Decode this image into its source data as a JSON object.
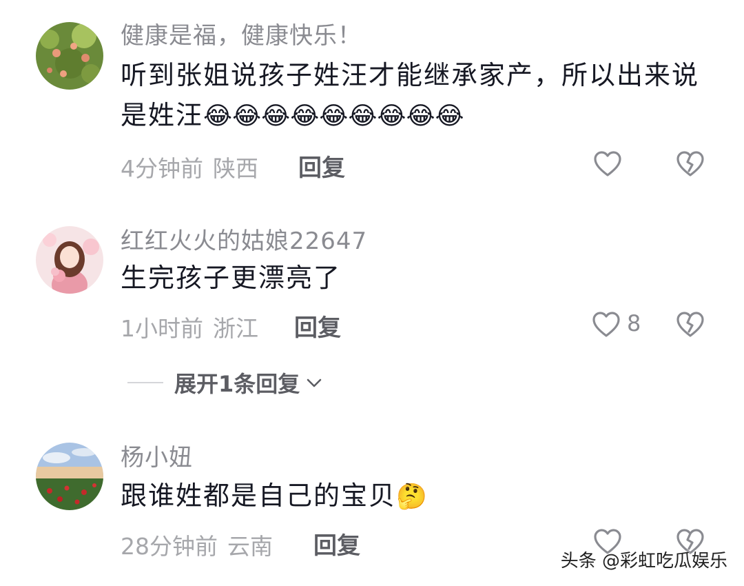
{
  "comments": [
    {
      "username": "健康是福，健康快乐！",
      "text": "听到张姐说孩子姓汪才能继承家产，所以出来说是姓汪",
      "emoji": "😂😂😂😂😂😂😂😂😂",
      "time": "4分钟前",
      "location": "陕西",
      "reply_label": "回复",
      "like_count": ""
    },
    {
      "username": "红红火火的姑娘22647",
      "text": "生完孩子更漂亮了",
      "emoji": "",
      "time": "1小时前",
      "location": "浙江",
      "reply_label": "回复",
      "like_count": "8"
    },
    {
      "username": "杨小妞",
      "text": "跟谁姓都是自己的宝贝",
      "emoji": "🤔",
      "time": "28分钟前",
      "location": "云南",
      "reply_label": "回复",
      "like_count": ""
    }
  ],
  "expand_replies_label": "展开1条回复",
  "watermark": "头条 @彩虹吃瓜娱乐",
  "icons": {
    "like": "heart-outline-icon",
    "dislike": "broken-heart-icon",
    "expand": "chevron-down-icon"
  },
  "colors": {
    "text_primary": "#161823",
    "text_secondary": "#8a8b91",
    "text_meta": "#a6a7ab"
  }
}
